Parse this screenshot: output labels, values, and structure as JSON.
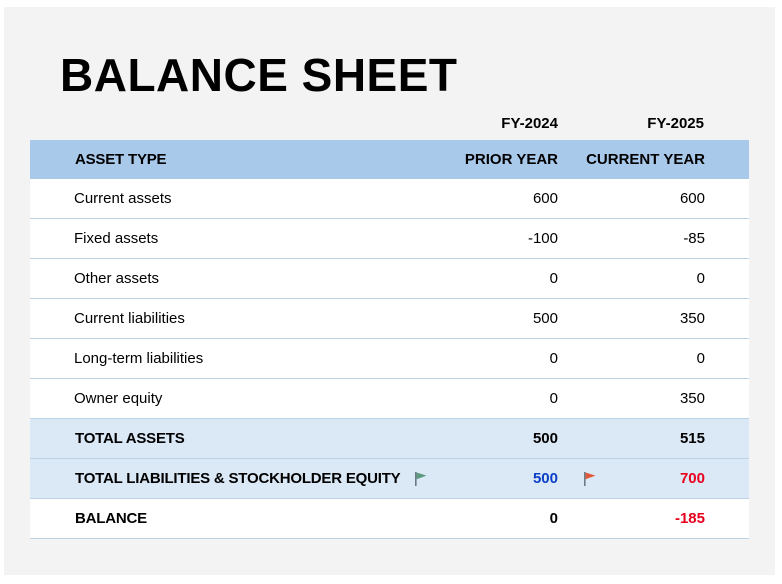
{
  "title": "BALANCE SHEET",
  "years": {
    "prior": "FY-2024",
    "current": "FY-2025"
  },
  "header": {
    "asset_type": "ASSET TYPE",
    "prior": "PRIOR YEAR",
    "current": "CURRENT YEAR"
  },
  "rows": [
    {
      "label": "Current assets",
      "prior": "600",
      "current": "600"
    },
    {
      "label": "Fixed assets",
      "prior": "-100",
      "current": "-85"
    },
    {
      "label": "Other assets",
      "prior": "0",
      "current": "0"
    },
    {
      "label": "Current liabilities",
      "prior": "500",
      "current": "350"
    },
    {
      "label": "Long-term liabilities",
      "prior": "0",
      "current": "0"
    },
    {
      "label": "Owner equity",
      "prior": "0",
      "current": "350"
    }
  ],
  "totals": {
    "assets": {
      "label": "TOTAL ASSETS",
      "prior": "500",
      "current": "515"
    },
    "liabilities_equity": {
      "label": "TOTAL LIABILITIES & STOCKHOLDER EQUITY",
      "prior": "500",
      "current": "700",
      "prior_flag_color": "#5b9a7c",
      "current_flag_color": "#e05a3a"
    },
    "balance": {
      "label": "BALANCE",
      "prior": "0",
      "current": "-185"
    }
  },
  "colors": {
    "header_bg": "#a9c9ea",
    "total_bg": "#dbe8f6",
    "blue_value": "#0b3fc5",
    "red_value": "#e8001c"
  },
  "icons": {
    "prior_flag": "green-flag-icon",
    "current_flag": "red-flag-icon"
  }
}
